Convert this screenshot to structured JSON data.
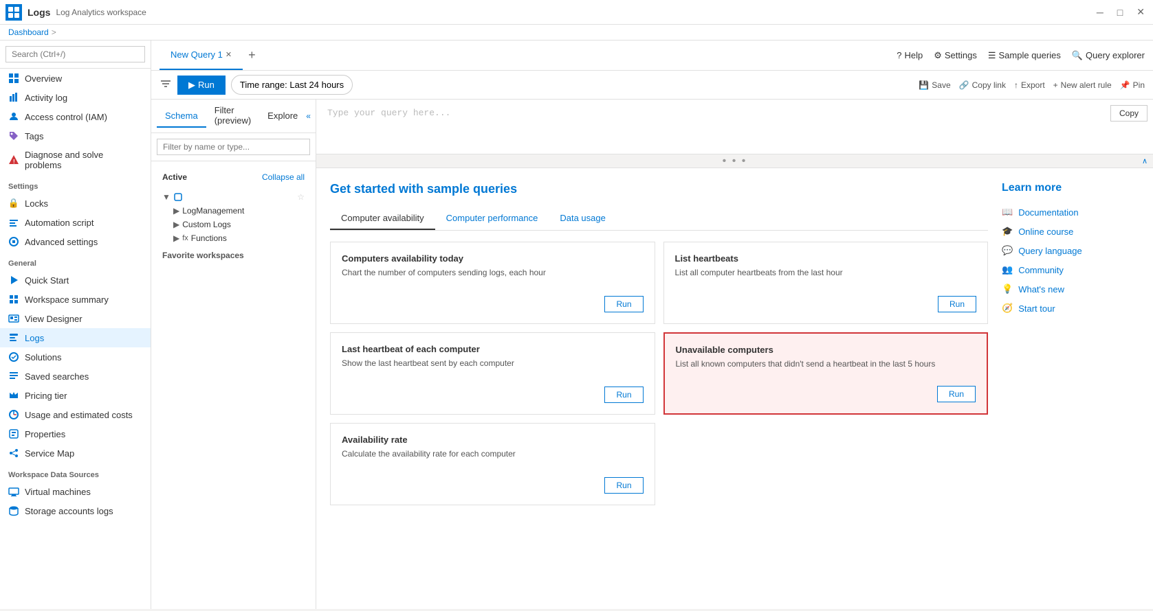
{
  "titleBar": {
    "appName": "Logs",
    "subtitle": "Log Analytics workspace",
    "closeBtn": "✕",
    "minimizeBtn": "─",
    "maximizeBtn": "□"
  },
  "breadcrumb": {
    "items": [
      "Dashboard",
      ">"
    ]
  },
  "topNav": {
    "tabs": [
      {
        "label": "New Query 1",
        "active": true
      },
      {
        "label": "+",
        "isAdd": true
      }
    ],
    "rightButtons": [
      {
        "label": "Help",
        "icon": "help-icon"
      },
      {
        "label": "Settings",
        "icon": "settings-icon"
      },
      {
        "label": "Sample queries",
        "icon": "list-icon"
      },
      {
        "label": "Query explorer",
        "icon": "query-explorer-icon"
      }
    ]
  },
  "toolbar": {
    "runLabel": "Run",
    "timeRangeLabel": "Time range: Last 24 hours",
    "settingsIcon": "settings-icon",
    "rightButtons": [
      {
        "label": "Save",
        "icon": "save-icon"
      },
      {
        "label": "Copy link",
        "icon": "link-icon"
      },
      {
        "label": "Export",
        "icon": "export-icon"
      },
      {
        "label": "New alert rule",
        "icon": "plus-icon"
      },
      {
        "label": "Pin",
        "icon": "pin-icon"
      }
    ]
  },
  "schema": {
    "tabs": [
      {
        "label": "Schema",
        "active": true
      },
      {
        "label": "Filter (preview)",
        "active": false
      },
      {
        "label": "Explore",
        "active": false
      }
    ],
    "searchPlaceholder": "Filter by name or type...",
    "collapseAllLabel": "Collapse all",
    "activeLabel": "Active",
    "favoriteWorkspacesLabel": "Favorite workspaces",
    "treeItems": [
      {
        "label": "LogManagement",
        "icon": "chevron-right"
      },
      {
        "label": "Custom Logs",
        "icon": "chevron-right"
      },
      {
        "label": "Functions",
        "icon": "chevron-right",
        "prefix": "fx"
      }
    ]
  },
  "queryEditor": {
    "placeholder": "Type your query here...",
    "copyLabel": "Copy"
  },
  "sampleQueries": {
    "title": "Get started with sample queries",
    "tabs": [
      {
        "label": "Computer availability",
        "active": true
      },
      {
        "label": "Computer performance",
        "active": false
      },
      {
        "label": "Data usage",
        "active": false
      }
    ],
    "cards": [
      {
        "title": "Computers availability today",
        "desc": "Chart the number of computers sending logs, each hour",
        "runLabel": "Run",
        "highlighted": false
      },
      {
        "title": "List heartbeats",
        "desc": "List all computer heartbeats from the last hour",
        "runLabel": "Run",
        "highlighted": false
      },
      {
        "title": "Last heartbeat of each computer",
        "desc": "Show the last heartbeat sent by each computer",
        "runLabel": "Run",
        "highlighted": false
      },
      {
        "title": "Unavailable computers",
        "desc": "List all known computers that didn't send a heartbeat in the last 5 hours",
        "runLabel": "Run",
        "highlighted": true
      },
      {
        "title": "Availability rate",
        "desc": "Calculate the availability rate for each computer",
        "runLabel": "Run",
        "highlighted": false
      }
    ]
  },
  "learnMore": {
    "title": "Learn more",
    "items": [
      {
        "label": "Documentation",
        "icon": "book-icon"
      },
      {
        "label": "Online course",
        "icon": "course-icon"
      },
      {
        "label": "Query language",
        "icon": "query-lang-icon"
      },
      {
        "label": "Community",
        "icon": "community-icon"
      },
      {
        "label": "What's new",
        "icon": "new-icon"
      },
      {
        "label": "Start tour",
        "icon": "tour-icon"
      }
    ]
  },
  "sidebar": {
    "searchPlaceholder": "Search (Ctrl+/)",
    "navItems": [
      {
        "label": "Overview",
        "icon": "overview-icon",
        "active": false
      },
      {
        "label": "Activity log",
        "icon": "activity-icon",
        "active": false
      },
      {
        "label": "Access control (IAM)",
        "icon": "iam-icon",
        "active": false
      },
      {
        "label": "Tags",
        "icon": "tags-icon",
        "active": false
      },
      {
        "label": "Diagnose and solve problems",
        "icon": "diagnose-icon",
        "active": false
      }
    ],
    "sections": [
      {
        "label": "Settings",
        "items": [
          {
            "label": "Locks",
            "icon": "lock-icon"
          },
          {
            "label": "Automation script",
            "icon": "script-icon"
          },
          {
            "label": "Advanced settings",
            "icon": "adv-settings-icon"
          }
        ]
      },
      {
        "label": "General",
        "items": [
          {
            "label": "Quick Start",
            "icon": "quickstart-icon"
          },
          {
            "label": "Workspace summary",
            "icon": "summary-icon"
          },
          {
            "label": "View Designer",
            "icon": "designer-icon"
          },
          {
            "label": "Logs",
            "icon": "logs-icon",
            "active": true
          },
          {
            "label": "Solutions",
            "icon": "solutions-icon"
          },
          {
            "label": "Saved searches",
            "icon": "saved-icon"
          },
          {
            "label": "Pricing tier",
            "icon": "pricing-icon"
          },
          {
            "label": "Usage and estimated costs",
            "icon": "usage-icon"
          },
          {
            "label": "Properties",
            "icon": "properties-icon"
          },
          {
            "label": "Service Map",
            "icon": "servicemap-icon"
          }
        ]
      },
      {
        "label": "Workspace Data Sources",
        "items": [
          {
            "label": "Virtual machines",
            "icon": "vm-icon"
          },
          {
            "label": "Storage accounts logs",
            "icon": "storage-icon"
          }
        ]
      }
    ]
  }
}
